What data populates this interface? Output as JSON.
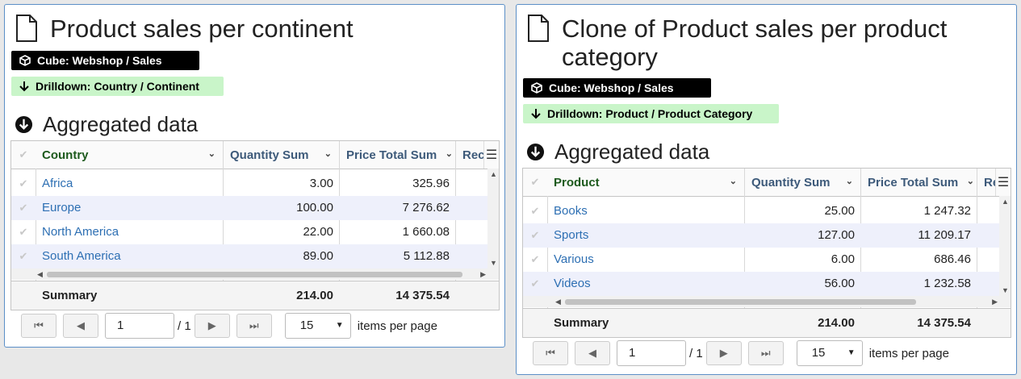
{
  "panels": [
    {
      "title": "Product sales per continent",
      "cube_badge": "Cube: Webshop / Sales",
      "drill_badge": "Drilldown: Country / Continent",
      "section_title": "Aggregated data",
      "columns": [
        "Country",
        "Quantity Sum",
        "Price Total Sum",
        "Rece"
      ],
      "rows": [
        {
          "label": "Africa",
          "qty": "3.00",
          "price": "325.96"
        },
        {
          "label": "Europe",
          "qty": "100.00",
          "price": "7 276.62"
        },
        {
          "label": "North America",
          "qty": "22.00",
          "price": "1 660.08"
        },
        {
          "label": "South America",
          "qty": "89.00",
          "price": "5 112.88"
        }
      ],
      "summary": {
        "label": "Summary",
        "qty": "214.00",
        "price": "14 375.54"
      },
      "pager": {
        "page": "1",
        "of": "/ 1",
        "per_page": "15",
        "per_page_label": "items per page"
      }
    },
    {
      "title": "Clone of Product sales per product category",
      "cube_badge": "Cube: Webshop / Sales",
      "drill_badge": "Drilldown: Product / Product Category",
      "section_title": "Aggregated data",
      "columns": [
        "Product",
        "Quantity Sum",
        "Price Total Sum",
        "Re"
      ],
      "rows": [
        {
          "label": "Books",
          "qty": "25.00",
          "price": "1 247.32"
        },
        {
          "label": "Sports",
          "qty": "127.00",
          "price": "11 209.17"
        },
        {
          "label": "Various",
          "qty": "6.00",
          "price": "686.46"
        },
        {
          "label": "Videos",
          "qty": "56.00",
          "price": "1 232.58"
        }
      ],
      "summary": {
        "label": "Summary",
        "qty": "214.00",
        "price": "14 375.54"
      },
      "pager": {
        "page": "1",
        "of": "/ 1",
        "per_page": "15",
        "per_page_label": "items per page"
      }
    }
  ]
}
